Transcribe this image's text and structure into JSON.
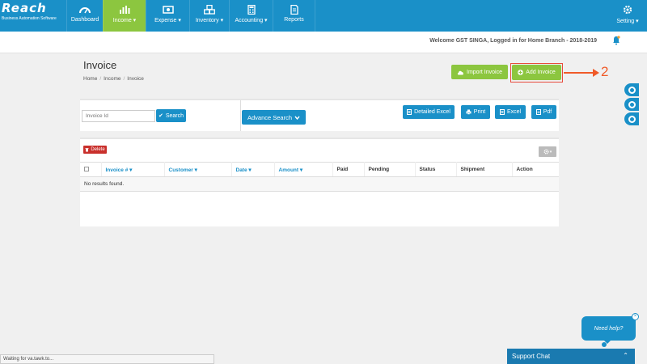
{
  "app": {
    "logo_text": "Reach",
    "logo_tagline": "Business Automation Software"
  },
  "nav": {
    "items": [
      {
        "label": "Dashboard",
        "icon": "speedometer-icon"
      },
      {
        "label": "Income ▾",
        "icon": "bar-chart-icon",
        "active": true
      },
      {
        "label": "Expense ▾",
        "icon": "money-icon"
      },
      {
        "label": "Inventory ▾",
        "icon": "cubes-icon"
      },
      {
        "label": "Accounting ▾",
        "icon": "calculator-icon"
      },
      {
        "label": "Reports",
        "icon": "document-icon"
      }
    ],
    "setting_label": "Setting ▾"
  },
  "header": {
    "welcome": "Welcome GST SINGA, Logged in for Home Branch - 2018-2019"
  },
  "page": {
    "title": "Invoice",
    "breadcrumb": [
      "Home",
      "Income",
      "Invoice"
    ]
  },
  "actions": {
    "import_label": "Import Invoice",
    "add_label": "Add Invoice",
    "annotation_number": "2"
  },
  "search": {
    "placeholder": "Invoice Id",
    "search_label": "Search",
    "advance_label": "Advance Search",
    "export": {
      "detailed_excel": "Detailed Excel",
      "print": "Print",
      "excel": "Excel",
      "pdf": "Pdf"
    }
  },
  "table": {
    "delete_label": "Delete",
    "columns": [
      "Invoice #",
      "Customer",
      "Date",
      "Amount",
      "Paid",
      "Pending",
      "Status",
      "Shipment",
      "Action"
    ],
    "empty_message": "No results found."
  },
  "chat": {
    "need_help": "Need help?",
    "support_label": "Support Chat"
  },
  "status_bar": "Waiting for va.tawk.to...",
  "colors": {
    "primary": "#1a90c8",
    "accent_green": "#8cc63f",
    "danger": "#c9302c",
    "annotation": "#f05a28"
  }
}
